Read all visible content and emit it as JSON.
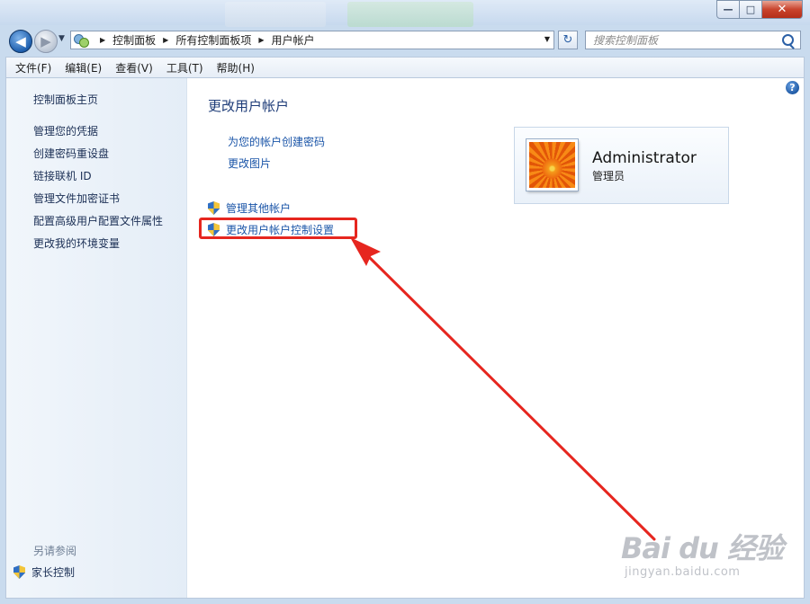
{
  "window": {
    "minimize": "—",
    "maximize": "□",
    "close": "✕"
  },
  "nav": {
    "back_glyph": "◀",
    "forward_glyph": "▶",
    "history_glyph": "▼",
    "refresh_glyph": "↻"
  },
  "breadcrumb": [
    "控制面板",
    "所有控制面板项",
    "用户帐户"
  ],
  "search": {
    "placeholder": "搜索控制面板"
  },
  "menu": [
    "文件(F)",
    "编辑(E)",
    "查看(V)",
    "工具(T)",
    "帮助(H)"
  ],
  "sidebar": {
    "home": "控制面板主页",
    "links": [
      "管理您的凭据",
      "创建密码重设盘",
      "链接联机 ID",
      "管理文件加密证书",
      "配置高级用户配置文件属性",
      "更改我的环境变量"
    ],
    "see_also": "另请参阅",
    "parental": "家长控制"
  },
  "main": {
    "title": "更改用户帐户",
    "links": [
      "为您的帐户创建密码",
      "更改图片"
    ],
    "shield_tasks": [
      "管理其他帐户",
      "更改用户帐户控制设置"
    ],
    "help_glyph": "?"
  },
  "user": {
    "name": "Administrator",
    "role": "管理员"
  },
  "annotation": {
    "color": "#e6261f"
  },
  "watermark": {
    "logo": "Bai du 经验",
    "url": "jingyan.baidu.com"
  }
}
